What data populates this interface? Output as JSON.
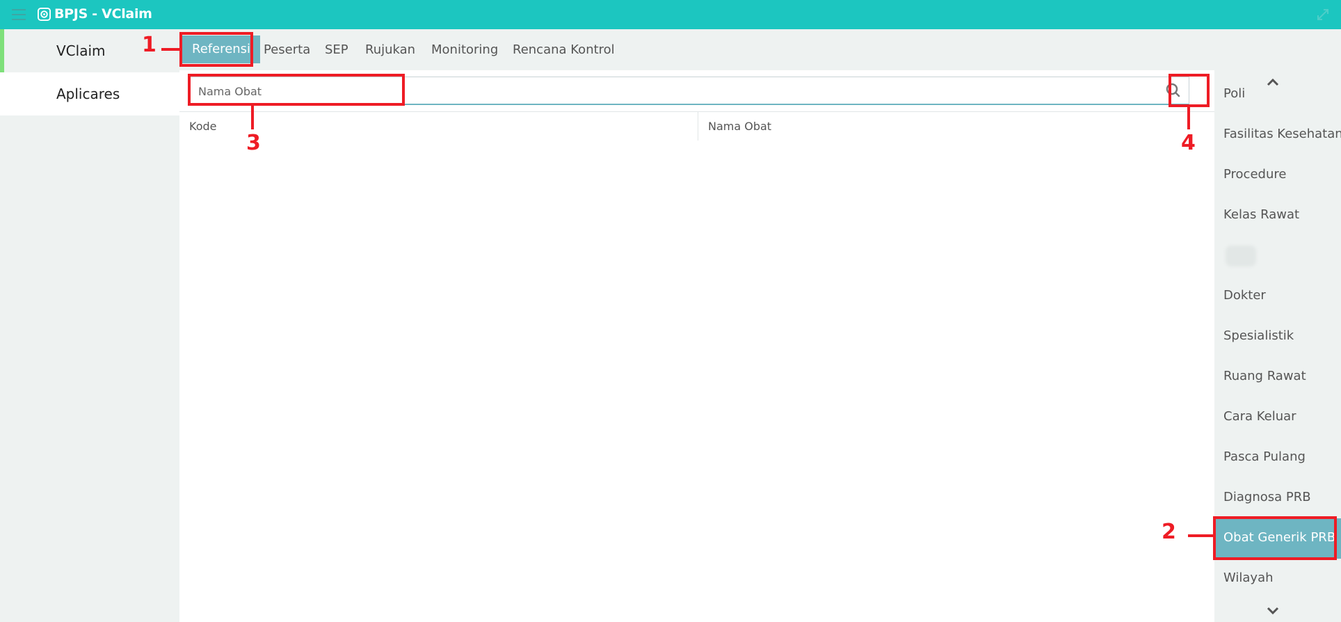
{
  "titlebar": {
    "title": "BPJS - VClaim"
  },
  "left_nav": {
    "items": [
      {
        "label": "VClaim"
      },
      {
        "label": "Aplicares"
      }
    ]
  },
  "tabs": [
    {
      "label": "Referensi",
      "active": true
    },
    {
      "label": "Peserta"
    },
    {
      "label": "SEP"
    },
    {
      "label": "Rujukan"
    },
    {
      "label": "Monitoring"
    },
    {
      "label": "Rencana Kontrol"
    }
  ],
  "search": {
    "placeholder": "Nama Obat",
    "value": ""
  },
  "table": {
    "columns": [
      "Kode",
      "Nama Obat"
    ],
    "rows": []
  },
  "right_nav": {
    "items": [
      {
        "label": "Poli"
      },
      {
        "label": "Fasilitas Kesehatan"
      },
      {
        "label": "Procedure"
      },
      {
        "label": "Kelas Rawat"
      },
      {
        "label": ""
      },
      {
        "label": "Dokter"
      },
      {
        "label": "Spesialistik"
      },
      {
        "label": "Ruang Rawat"
      },
      {
        "label": "Cara Keluar"
      },
      {
        "label": "Pasca Pulang"
      },
      {
        "label": "Diagnosa PRB"
      },
      {
        "label": "Obat Generik PRB",
        "active": true
      },
      {
        "label": "Wilayah"
      }
    ]
  },
  "annotations": [
    "1",
    "2",
    "3",
    "4"
  ],
  "colors": {
    "titlebar": "#1cc6c0",
    "accent": "#6eb5c2",
    "annotation": "#ee1c25",
    "nav_bg": "#eef2f1"
  }
}
